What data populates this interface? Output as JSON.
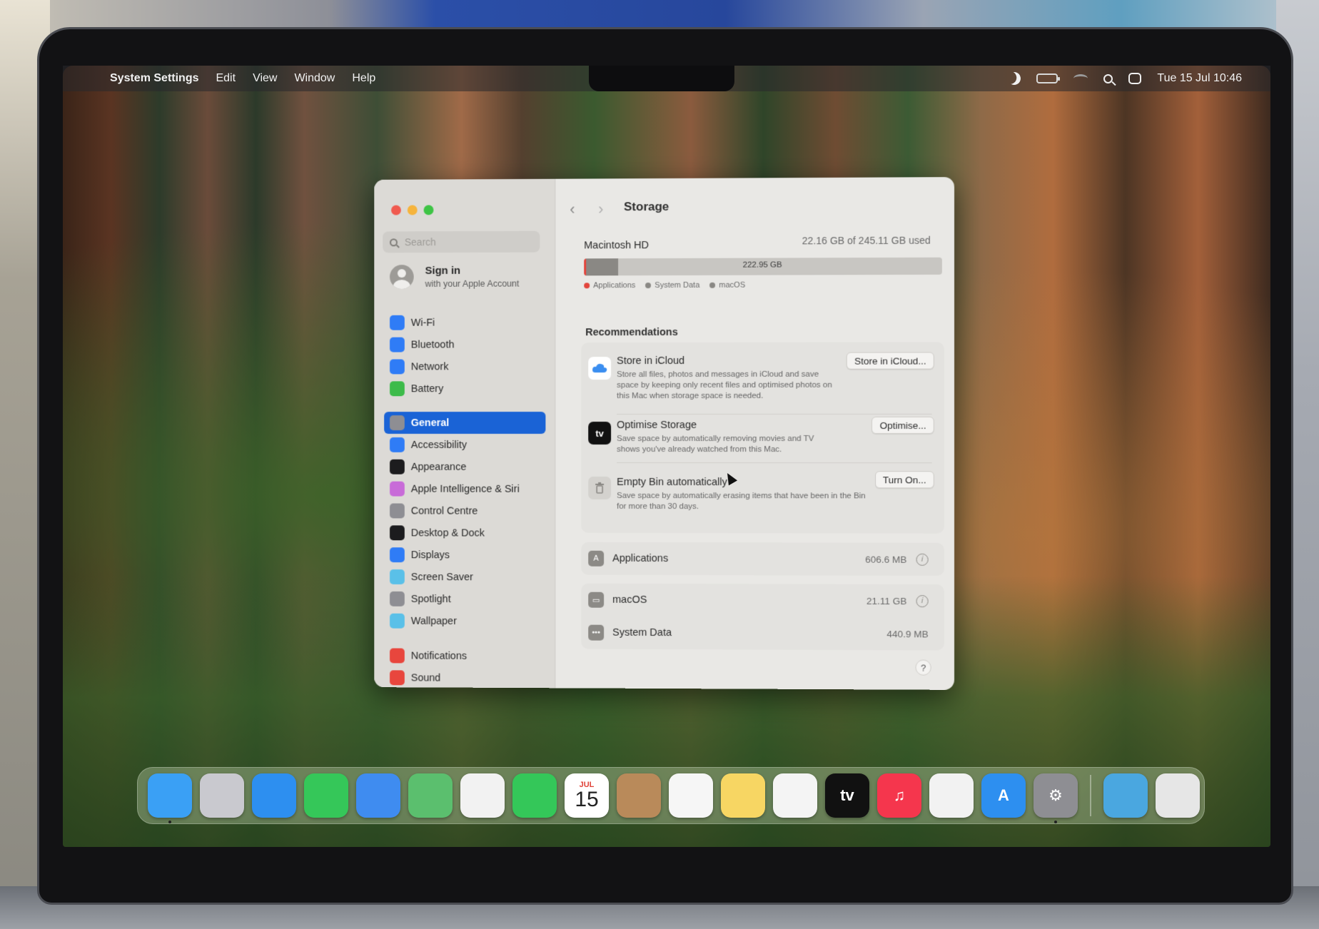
{
  "menubar": {
    "apple": "",
    "app_name": "System Settings",
    "menus": [
      "Edit",
      "View",
      "Window",
      "Help"
    ],
    "clock": "Tue 15 Jul  10:46"
  },
  "sidebar": {
    "search_placeholder": "Search",
    "signin_title": "Sign in",
    "signin_subtitle": "with your Apple Account",
    "group1": [
      {
        "label": "Wi-Fi",
        "icon": "wifi-icon",
        "color": "#2f7cf6"
      },
      {
        "label": "Bluetooth",
        "icon": "bluetooth-icon",
        "color": "#2f7cf6"
      },
      {
        "label": "Network",
        "icon": "network-icon",
        "color": "#2f7cf6"
      },
      {
        "label": "Battery",
        "icon": "battery-icon",
        "color": "#3dbb4a"
      }
    ],
    "group2": [
      {
        "label": "General",
        "icon": "gear-icon",
        "color": "#8e8e93",
        "selected": true
      },
      {
        "label": "Accessibility",
        "icon": "accessibility-icon",
        "color": "#2f7cf6"
      },
      {
        "label": "Appearance",
        "icon": "appearance-icon",
        "color": "#1c1c1e"
      },
      {
        "label": "Apple Intelligence & Siri",
        "icon": "siri-icon",
        "color": "#c86bd8"
      },
      {
        "label": "Control Centre",
        "icon": "control-centre-icon",
        "color": "#8e8e93"
      },
      {
        "label": "Desktop & Dock",
        "icon": "dock-icon",
        "color": "#1c1c1e"
      },
      {
        "label": "Displays",
        "icon": "sun-icon",
        "color": "#2f7cf6"
      },
      {
        "label": "Screen Saver",
        "icon": "screen-saver-icon",
        "color": "#5ac0e8"
      },
      {
        "label": "Spotlight",
        "icon": "search-icon",
        "color": "#8e8e93"
      },
      {
        "label": "Wallpaper",
        "icon": "flower-icon",
        "color": "#5ac0e8"
      }
    ],
    "group3": [
      {
        "label": "Notifications",
        "icon": "bell-icon",
        "color": "#e8463d"
      },
      {
        "label": "Sound",
        "icon": "speaker-icon",
        "color": "#e8463d"
      }
    ]
  },
  "content": {
    "title": "Storage",
    "disk": {
      "name": "Macintosh HD",
      "used_text": "22.16 GB of 245.11 GB used",
      "available_text": "222.95 GB",
      "used_fraction": 0.0904
    },
    "legend": [
      {
        "label": "Applications",
        "color": "#e2453c"
      },
      {
        "label": "System Data",
        "color": "#8a8884"
      },
      {
        "label": "macOS",
        "color": "#8a8884"
      }
    ],
    "recommendations_title": "Recommendations",
    "recommendations": [
      {
        "title": "Store in iCloud",
        "desc": "Store all files, photos and messages in iCloud and save space by keeping only recent files and optimised photos on this Mac when storage space is needed.",
        "button": "Store in iCloud...",
        "icon": "icloud-icon"
      },
      {
        "title": "Optimise Storage",
        "desc": "Save space by automatically removing movies and TV shows you've already watched from this Mac.",
        "button": "Optimise...",
        "icon": "appletv-icon",
        "icon_text": "tv"
      },
      {
        "title": "Empty Bin automatically",
        "desc": "Save space by automatically erasing items that have been in the Bin for more than 30 days.",
        "button": "Turn On...",
        "icon": "bin-icon"
      }
    ],
    "categories": [
      {
        "name": "Applications",
        "size": "606.6 MB",
        "icon": "applications-icon",
        "info": true
      },
      {
        "name": "macOS",
        "size": "21.11 GB",
        "icon": "laptop-icon",
        "info": true
      },
      {
        "name": "System Data",
        "size": "440.9 MB",
        "icon": "ellipsis-icon",
        "info": false
      }
    ],
    "help": "?"
  },
  "dock": {
    "apps": [
      {
        "name": "finder-icon",
        "bg": "#3aa0f5",
        "running": true
      },
      {
        "name": "launchpad-icon",
        "bg": "#c9c9cf"
      },
      {
        "name": "safari-icon",
        "bg": "#2d8ff0"
      },
      {
        "name": "messages-icon",
        "bg": "#35c759"
      },
      {
        "name": "mail-icon",
        "bg": "#3f8cf0"
      },
      {
        "name": "maps-icon",
        "bg": "#5bbf6e"
      },
      {
        "name": "photos-icon",
        "bg": "#f2f2f2"
      },
      {
        "name": "facetime-icon",
        "bg": "#34c759"
      },
      {
        "name": "calendar-icon",
        "bg": "#ffffff",
        "month": "JUL",
        "day": "15"
      },
      {
        "name": "contacts-icon",
        "bg": "#b98a5a"
      },
      {
        "name": "reminders-icon",
        "bg": "#f6f6f6"
      },
      {
        "name": "notes-icon",
        "bg": "#f7d663"
      },
      {
        "name": "freeform-icon",
        "bg": "#f4f4f4"
      },
      {
        "name": "tv-icon",
        "bg": "#111111",
        "label": "tv"
      },
      {
        "name": "music-icon",
        "bg": "#f5364d",
        "label": "♫"
      },
      {
        "name": "news-icon",
        "bg": "#f2f2f2"
      },
      {
        "name": "app-store-icon",
        "bg": "#2d8ff0",
        "label": "A"
      },
      {
        "name": "system-settings-icon",
        "bg": "#8e8e93",
        "label": "⚙",
        "running": true
      }
    ],
    "extras": [
      {
        "name": "downloads-folder-icon",
        "bg": "#4aa7e0"
      },
      {
        "name": "trash-icon",
        "bg": "#e6e6e6"
      }
    ]
  }
}
